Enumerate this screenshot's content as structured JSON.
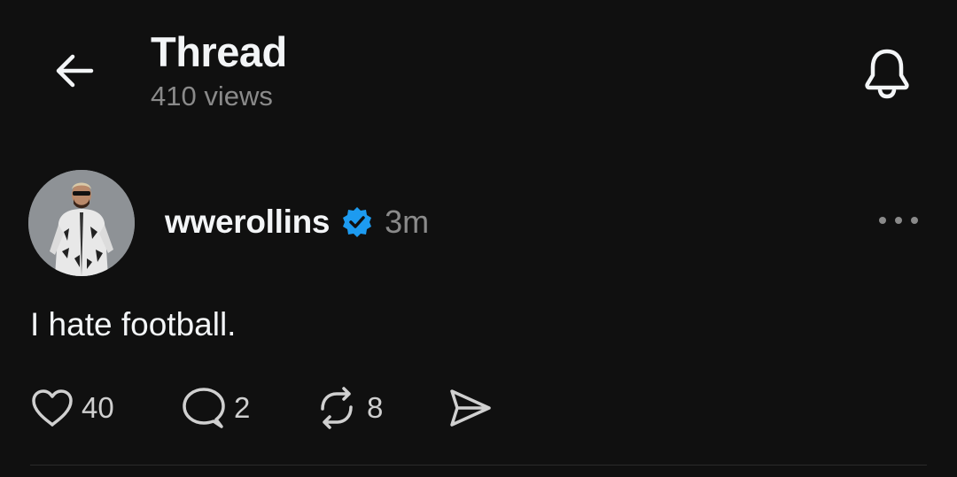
{
  "header": {
    "title": "Thread",
    "views": "410 views",
    "back_icon": "arrow-left-icon",
    "notification_icon": "bell-icon"
  },
  "post": {
    "author": {
      "username": "wwerollins",
      "verified": true,
      "verified_color": "#1d9bf0"
    },
    "timestamp": "3m",
    "text": "I hate football.",
    "actions": {
      "likes": "40",
      "replies": "2",
      "reposts": "8"
    }
  },
  "colors": {
    "background": "#101010",
    "text": "#f3f5f7",
    "secondary_text": "#8a8a8a",
    "accent_verified": "#1d9bf0"
  }
}
